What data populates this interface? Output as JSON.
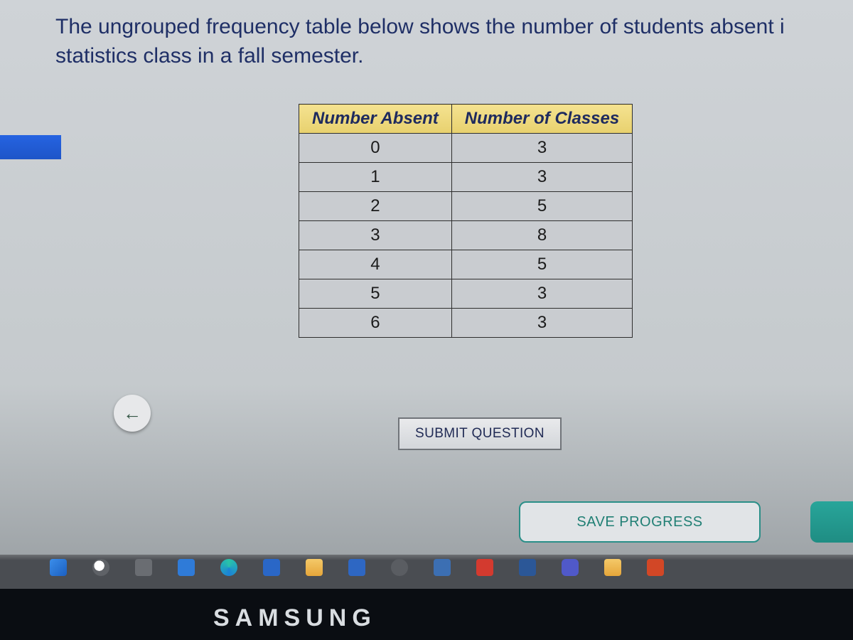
{
  "prompt_text": "The ungrouped frequency table below shows the number of students absent i statistics class in a fall semester.",
  "table": {
    "headers": [
      "Number Absent",
      "Number of Classes"
    ],
    "rows": [
      {
        "absent": "0",
        "classes": "3"
      },
      {
        "absent": "1",
        "classes": "3"
      },
      {
        "absent": "2",
        "classes": "5"
      },
      {
        "absent": "3",
        "classes": "8"
      },
      {
        "absent": "4",
        "classes": "5"
      },
      {
        "absent": "5",
        "classes": "3"
      },
      {
        "absent": "6",
        "classes": "3"
      }
    ]
  },
  "buttons": {
    "prev_glyph": "←",
    "submit_label": "SUBMIT QUESTION",
    "save_label": "SAVE PROGRESS"
  },
  "device_brand": "SAMSUNG",
  "chart_data": {
    "type": "table",
    "title": "Ungrouped frequency table: number of students absent in statistics class (fall semester)",
    "columns": [
      "Number Absent",
      "Number of Classes"
    ],
    "rows": [
      [
        0,
        3
      ],
      [
        1,
        3
      ],
      [
        2,
        5
      ],
      [
        3,
        8
      ],
      [
        4,
        5
      ],
      [
        5,
        3
      ],
      [
        6,
        3
      ]
    ]
  }
}
